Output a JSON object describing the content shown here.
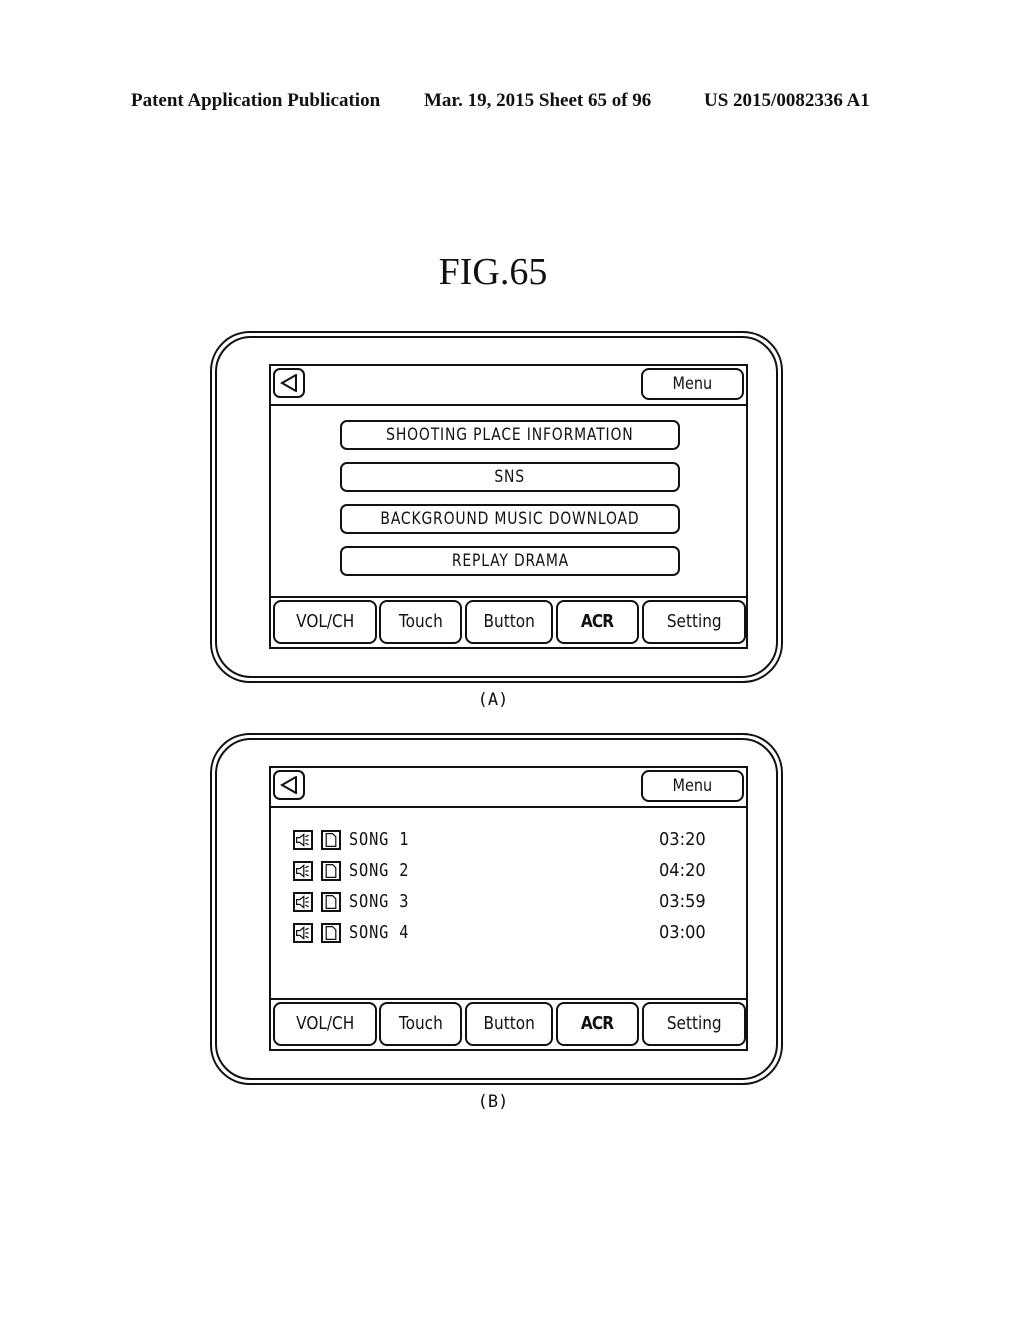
{
  "header": {
    "publication": "Patent Application Publication",
    "date_sheet": "Mar. 19, 2015  Sheet 65 of 96",
    "number": "US 2015/0082336 A1"
  },
  "figure_title": "FIG.65",
  "panel_a": {
    "caption": "(A)",
    "back_icon": "back-triangle-icon",
    "menu_label": "Menu",
    "options": [
      "SHOOTING PLACE INFORMATION",
      "SNS",
      "BACKGROUND MUSIC DOWNLOAD",
      "REPLAY DRAMA"
    ],
    "tabs": [
      "VOL/CH",
      "Touch",
      "Button",
      "ACR",
      "Setting"
    ],
    "active_tab": "ACR"
  },
  "panel_b": {
    "caption": "(B)",
    "back_icon": "back-triangle-icon",
    "menu_label": "Menu",
    "songs": [
      {
        "name": "SONG  1",
        "duration": "03:20",
        "icons": [
          "speaker-icon",
          "document-icon"
        ]
      },
      {
        "name": "SONG  2",
        "duration": "04:20",
        "icons": [
          "speaker-icon",
          "document-icon"
        ]
      },
      {
        "name": "SONG  3",
        "duration": "03:59",
        "icons": [
          "speaker-icon",
          "document-icon"
        ]
      },
      {
        "name": "SONG  4",
        "duration": "03:00",
        "icons": [
          "speaker-icon",
          "document-icon"
        ]
      }
    ],
    "tabs": [
      "VOL/CH",
      "Touch",
      "Button",
      "ACR",
      "Setting"
    ],
    "active_tab": "ACR"
  }
}
